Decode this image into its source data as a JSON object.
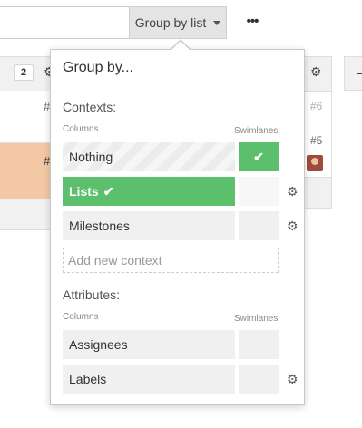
{
  "toolbar": {
    "group_by_label": "Group by list",
    "more_label": "•••"
  },
  "board": {
    "left_count": "2",
    "left_refs": [
      "#",
      "#"
    ],
    "right_refs": [
      "#6",
      "#5"
    ],
    "gear_icon": "⚙"
  },
  "popover": {
    "title": "Group by...",
    "contexts": {
      "heading": "Contexts:",
      "columns_label": "Columns",
      "swimlanes_label": "Swimlanes",
      "items": [
        {
          "label": "Nothing",
          "active": false,
          "swimlane_checked": true
        },
        {
          "label": "Lists",
          "active": true,
          "check": "✔"
        },
        {
          "label": "Milestones",
          "active": false
        }
      ],
      "add_placeholder": "Add new context",
      "swimlane_check": "✔"
    },
    "attributes": {
      "heading": "Attributes:",
      "columns_label": "Columns",
      "swimlanes_label": "Swimlanes",
      "items": [
        {
          "label": "Assignees"
        },
        {
          "label": "Labels"
        }
      ]
    }
  },
  "colors": {
    "accent_green": "#5cbf6c",
    "card_highlight": "#f3c8a5"
  }
}
